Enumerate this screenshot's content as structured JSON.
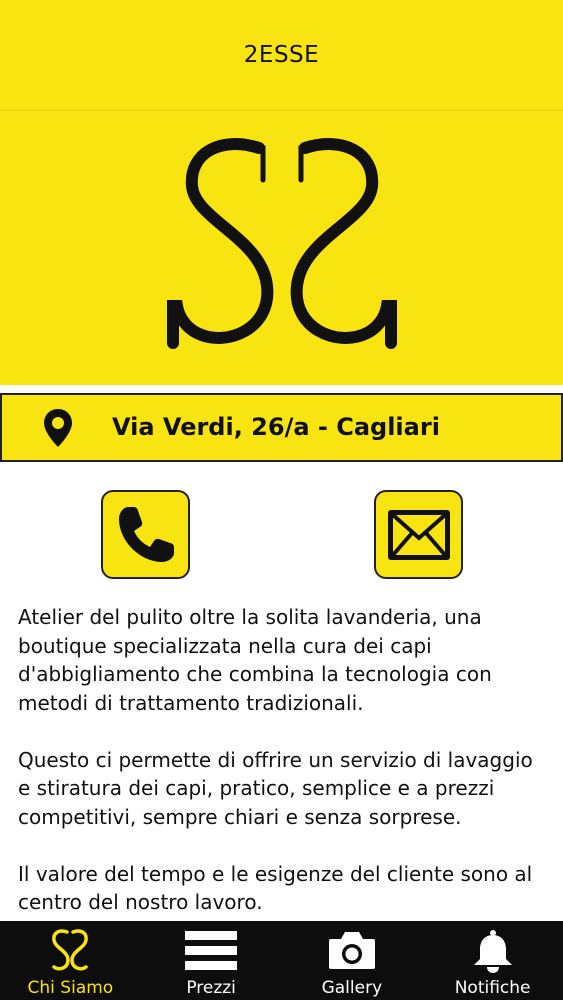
{
  "header": {
    "title": "2ESSE"
  },
  "hero": {
    "logo_icon": "ss-logo-icon"
  },
  "address": {
    "icon": "map-pin-icon",
    "text": "Via Verdi, 26/a - Cagliari"
  },
  "actions": [
    {
      "icon": "phone-icon"
    },
    {
      "icon": "mail-icon"
    }
  ],
  "content": {
    "paragraphs": [
      "Atelier del pulito oltre la solita lavanderia, una boutique specializzata nella cura dei capi d'abbigliamento che combina la tecnologia con metodi di trattamento tradizionali.",
      "Questo ci permette di offrire un servizio di lavaggio e stiratura dei capi, pratico, semplice e a prezzi competitivi, sempre chiari e senza sorprese.",
      "Il valore del tempo e le esigenze del cliente sono al centro del nostro lavoro."
    ]
  },
  "nav": {
    "items": [
      {
        "label": "Chi Siamo",
        "icon": "ss-logo-icon",
        "active": true
      },
      {
        "label": "Prezzi",
        "icon": "menu-lines-icon",
        "active": false
      },
      {
        "label": "Gallery",
        "icon": "camera-icon",
        "active": false
      },
      {
        "label": "Notifiche",
        "icon": "bell-icon",
        "active": false
      }
    ]
  },
  "colors": {
    "accent": "#f8e410",
    "nav_bg": "#0d0d0d",
    "text": "#111111"
  }
}
